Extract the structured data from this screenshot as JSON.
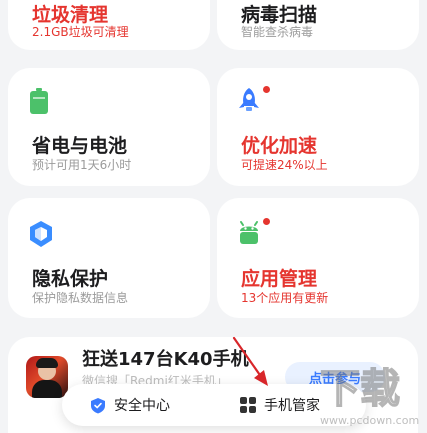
{
  "cards": {
    "junk": {
      "title": "垃圾清理",
      "sub": "2.1GB垃圾可清理"
    },
    "virus": {
      "title": "病毒扫描",
      "sub": "智能查杀病毒"
    },
    "battery": {
      "title": "省电与电池",
      "sub": "预计可用1天6小时"
    },
    "optimize": {
      "title": "优化加速",
      "sub": "可提速24%以上"
    },
    "privacy": {
      "title": "隐私保护",
      "sub": "保护隐私数据信息"
    },
    "apps": {
      "title": "应用管理",
      "sub": "13个应用有更新"
    }
  },
  "promo": {
    "title": "狂送147台K40手机",
    "subtitle": "微信搜「Redmi红米手机」",
    "join_label": "点击参与"
  },
  "tabbar": {
    "security_center": "安全中心",
    "phone_manager": "手机管家"
  },
  "watermark": {
    "text": "www.pcdown.com"
  },
  "colors": {
    "accent_red": "#e5352f",
    "icon_green": "#4cc16a",
    "icon_blue": "#3a7bff",
    "background": "#f3f4f6"
  },
  "icons": {
    "battery": "battery-icon",
    "rocket": "rocket-icon",
    "privacy": "shield-cube-icon",
    "apps": "android-icon",
    "shield": "shield-icon",
    "grid": "grid-icon"
  }
}
